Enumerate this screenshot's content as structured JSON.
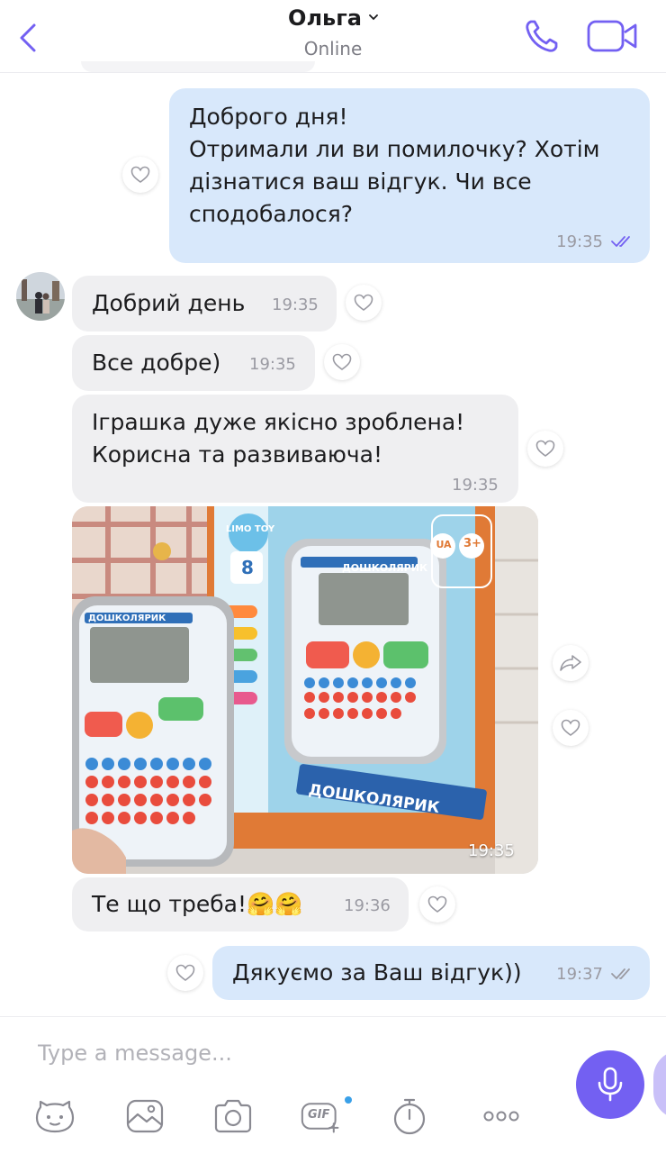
{
  "header": {
    "contact_name": "Ольга",
    "status": "Online"
  },
  "messages": [
    {
      "direction": "out",
      "text": "Доброго дня!\nОтримали ли ви помилочку? Хотім дізнатися ваш відгук. Чи все сподобалося?",
      "time": "19:35",
      "read": true
    },
    {
      "direction": "in",
      "text": "Добрий день",
      "time": "19:35"
    },
    {
      "direction": "in",
      "text": "Все добре)",
      "time": "19:35"
    },
    {
      "direction": "in",
      "text": "Іграшка дуже якісно зроблена!\nКорисна та развиваюча!",
      "time": "19:35"
    },
    {
      "direction": "in",
      "type": "photo",
      "time": "19:35",
      "photo": {
        "box_title": "ДОШКОЛЯРИК",
        "brand": "LIMO TOY",
        "lang_badge": "UA",
        "age_badge": "3+",
        "modes": "8"
      }
    },
    {
      "direction": "in",
      "text": "Те що треба!🤗🤗",
      "time": "19:36"
    },
    {
      "direction": "out",
      "text": "Дякуємо за Ваш відгук))",
      "time": "19:37",
      "read": true
    }
  ],
  "composer": {
    "placeholder": "Type a message..."
  },
  "toolbar": {
    "items": [
      "sticker-icon",
      "gallery-icon",
      "camera-icon",
      "gif-icon",
      "timer-icon",
      "more-icon"
    ],
    "gif_label": "GIF"
  },
  "colors": {
    "accent": "#7360f2",
    "outgoing_bubble": "#d8e8fb",
    "incoming_bubble": "#efeff1"
  }
}
